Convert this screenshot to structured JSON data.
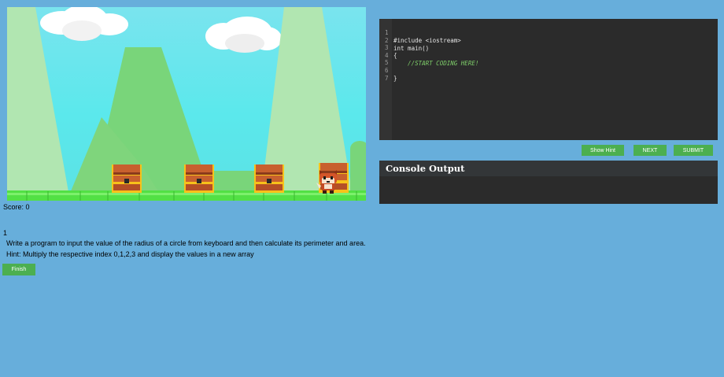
{
  "game": {
    "score_label": "Score: 0",
    "colors": {
      "sky": "#6ee6ee",
      "mountain_pale": "#b1e6b1",
      "mountain_green": "#79d57a",
      "ground": "#52e045",
      "chest_gold": "#f7c21a",
      "chest_wood": "#c8602e"
    },
    "sprites": [
      "treasure-chest",
      "treasure-chest",
      "treasure-chest",
      "treasure-chest",
      "fox-player"
    ]
  },
  "task": {
    "level_number": "1",
    "question": "Write a program to input the value of the radius of a circle from keyboard and then calculate its perimeter and area.",
    "hint": "Hint: Multiply the respective index 0,1,2,3 and display the values in a new array",
    "finish_label": "Finish"
  },
  "editor": {
    "lines": [
      {
        "num": "1",
        "text": "#include <iostream>"
      },
      {
        "num": "2",
        "text": "int main()"
      },
      {
        "num": "3",
        "text": "{"
      },
      {
        "num": "4",
        "text": "    //START CODING HERE!"
      },
      {
        "num": "5",
        "text": ""
      },
      {
        "num": "6",
        "text": "}"
      },
      {
        "num": "7",
        "text": ""
      }
    ]
  },
  "toolbar": {
    "hint_label": "Show Hint",
    "next_label": "NEXT",
    "submit_label": "SUBMIT",
    "button_color": "#4caf50"
  },
  "console": {
    "title": "Console Output",
    "output": ""
  }
}
